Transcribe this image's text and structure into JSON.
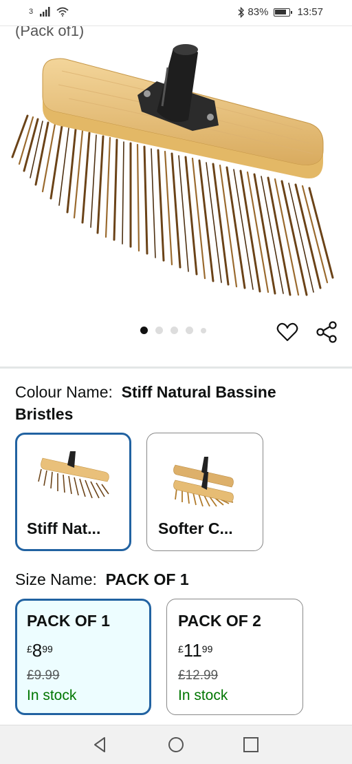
{
  "status_bar": {
    "sim": "3",
    "battery": "83%",
    "time": "13:57",
    "icons": [
      "signal-icon",
      "wifi-icon",
      "bluetooth-icon",
      "battery-icon"
    ]
  },
  "product_image": {
    "caption": "(Pack of1)",
    "carousel_count": 5,
    "carousel_active": 1
  },
  "colour": {
    "heading": "Colour Name:",
    "value": "Stiff Natural Bassine Bristles",
    "options": [
      {
        "label": "Stiff Nat...",
        "selected": true
      },
      {
        "label": "Softer C...",
        "selected": false
      }
    ]
  },
  "size": {
    "heading": "Size Name:",
    "value": "PACK OF 1",
    "options": [
      {
        "title": "PACK OF 1",
        "currency": "£",
        "whole": "8",
        "fraction": "99",
        "was": "£9.99",
        "stock": "In stock",
        "selected": true
      },
      {
        "title": "PACK OF 2",
        "currency": "£",
        "whole": "11",
        "fraction": "99",
        "was": "£12.99",
        "stock": "In stock",
        "selected": false
      }
    ]
  },
  "colors": {
    "selected_border": "#2162a1",
    "selected_bg": "#edfdff",
    "in_stock": "#007600"
  },
  "nav": [
    "back-icon",
    "home-icon",
    "recents-icon"
  ]
}
